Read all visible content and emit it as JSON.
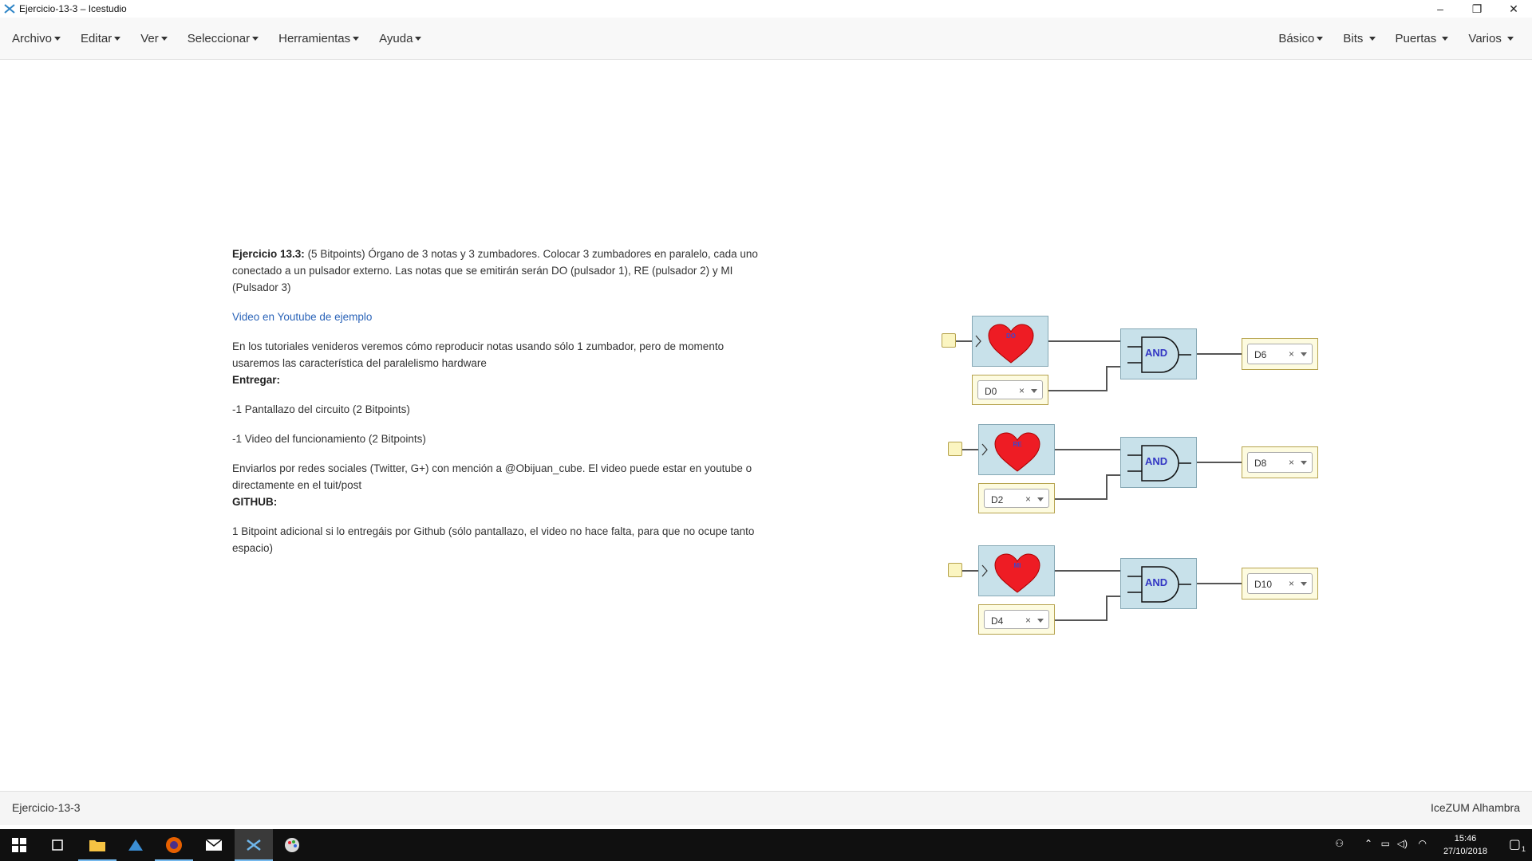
{
  "window": {
    "title": "Ejercicio-13-3 – Icestudio",
    "minimize": "–",
    "restore": "❐",
    "close": "✕"
  },
  "menu": {
    "left": [
      "Archivo",
      "Editar",
      "Ver",
      "Seleccionar",
      "Herramientas",
      "Ayuda"
    ],
    "right": [
      "Básico",
      "Bits",
      "Puertas",
      "Varios"
    ]
  },
  "info": {
    "title_bold": "Ejercicio 13.3:",
    "title_rest": " (5 Bitpoints) Órgano de 3 notas y 3 zumbadores. Colocar 3 zumbadores en paralelo, cada uno conectado a un pulsador externo. Las notas que se emitirán serán DO (pulsador 1), RE (pulsador 2) y MI (Pulsador 3)",
    "link": "Video en Youtube de ejemplo",
    "p1": "En los tutoriales venideros veremos cómo reproducir notas usando sólo 1 zumbador, pero de momento usaremos las característica del paralelismo hardware",
    "entregar": "Entregar:",
    "item1": "-1 Pantallazo del circuito (2 Bitpoints)",
    "item2": "-1 Video del funcionamiento (2 Bitpoints)",
    "p2": "Enviarlos por redes sociales (Twitter, G+) con mención a @Obijuan_cube. El video puede estar en youtube o directamente en el tuit/post",
    "github": "GITHUB:",
    "p3": "1 Bitpoint adicional si lo entregáis por Github (sólo pantallazo, el video no hace falta, para que no ocupe tanto espacio)"
  },
  "circuit": {
    "rows": [
      {
        "note": "DO",
        "input_pin": "D0",
        "output_pin": "D6",
        "gate": "AND"
      },
      {
        "note": "RE",
        "input_pin": "D2",
        "output_pin": "D8",
        "gate": "AND"
      },
      {
        "note": "MI",
        "input_pin": "D4",
        "output_pin": "D10",
        "gate": "AND"
      }
    ],
    "clear": "×"
  },
  "status": {
    "left": "Ejercicio-13-3",
    "right": "IceZUM Alhambra"
  },
  "taskbar": {
    "time": "15:46",
    "date": "27/10/2018",
    "notifications": "1"
  },
  "colors": {
    "block_fill": "#c8e1ea",
    "pin_fill": "#fdfbe0",
    "heart": "#ee1c24",
    "link": "#2a63b8"
  }
}
